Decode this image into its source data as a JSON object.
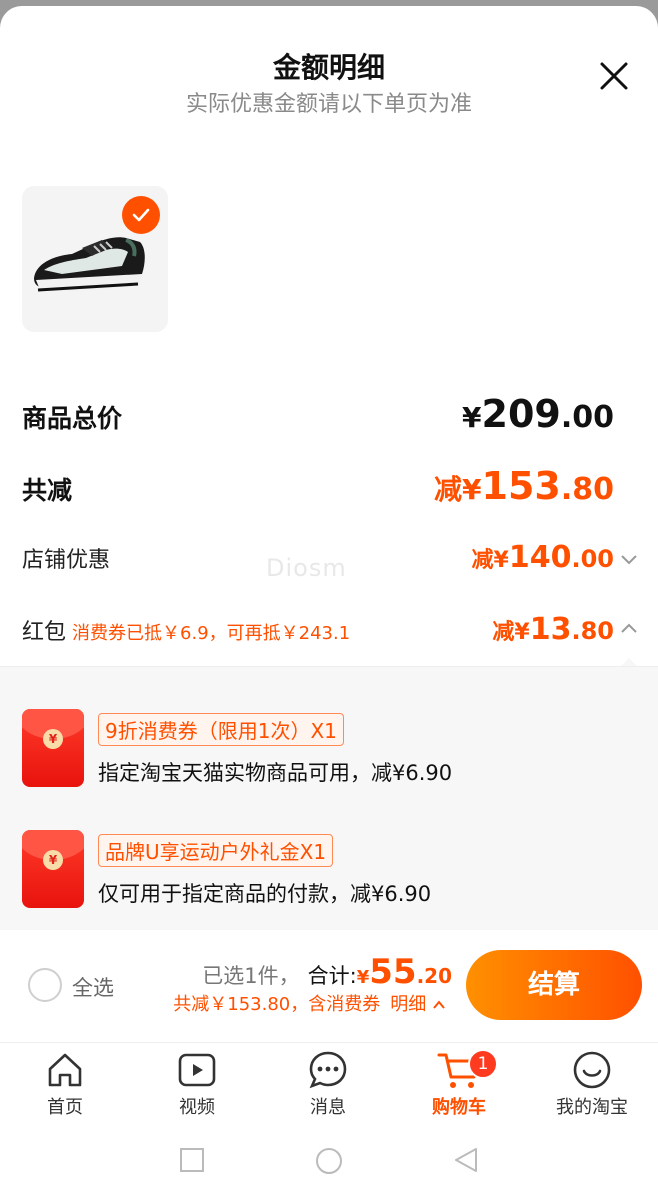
{
  "header": {
    "title": "金额明细",
    "subtitle": "实际优惠金额请以下单页为准"
  },
  "summary": {
    "total_label": "商品总价",
    "total_symbol": "¥",
    "total_int": "209",
    "total_dec": ".00",
    "discount_label": "共减",
    "discount_prefix": "减¥",
    "discount_int": "153",
    "discount_dec": ".80"
  },
  "store_discount": {
    "label": "店铺优惠",
    "prefix": "减¥",
    "int": "140",
    "dec": ".00"
  },
  "redpacket": {
    "label": "红包",
    "note": "消费券已抵￥6.9，可再抵￥243.1",
    "prefix": "减¥",
    "int": "13",
    "dec": ".80"
  },
  "watermark": "Diosm",
  "coupons": [
    {
      "tag": "9折消费券（限用1次）X1",
      "desc": "指定淘宝天猫实物商品可用，减¥6.90"
    },
    {
      "tag": "品牌U享运动户外礼金X1",
      "desc": "仅可用于指定商品的付款，减¥6.90"
    }
  ],
  "bottom": {
    "select_all": "全选",
    "selected": "已选1件，",
    "total_label": "合计:",
    "total_symbol": "¥",
    "total_int": "55",
    "total_dec": ".20",
    "saved": "共减￥153.80，含消费券",
    "detail": "明细",
    "checkout": "结算"
  },
  "tabs": [
    {
      "label": "首页",
      "icon": "home-icon"
    },
    {
      "label": "视频",
      "icon": "video-icon"
    },
    {
      "label": "消息",
      "icon": "message-icon"
    },
    {
      "label": "购物车",
      "icon": "cart-icon",
      "badge": "1"
    },
    {
      "label": "我的淘宝",
      "icon": "profile-icon"
    }
  ],
  "colors": {
    "accent": "#ff5000",
    "checkout_start": "#ff9000"
  }
}
